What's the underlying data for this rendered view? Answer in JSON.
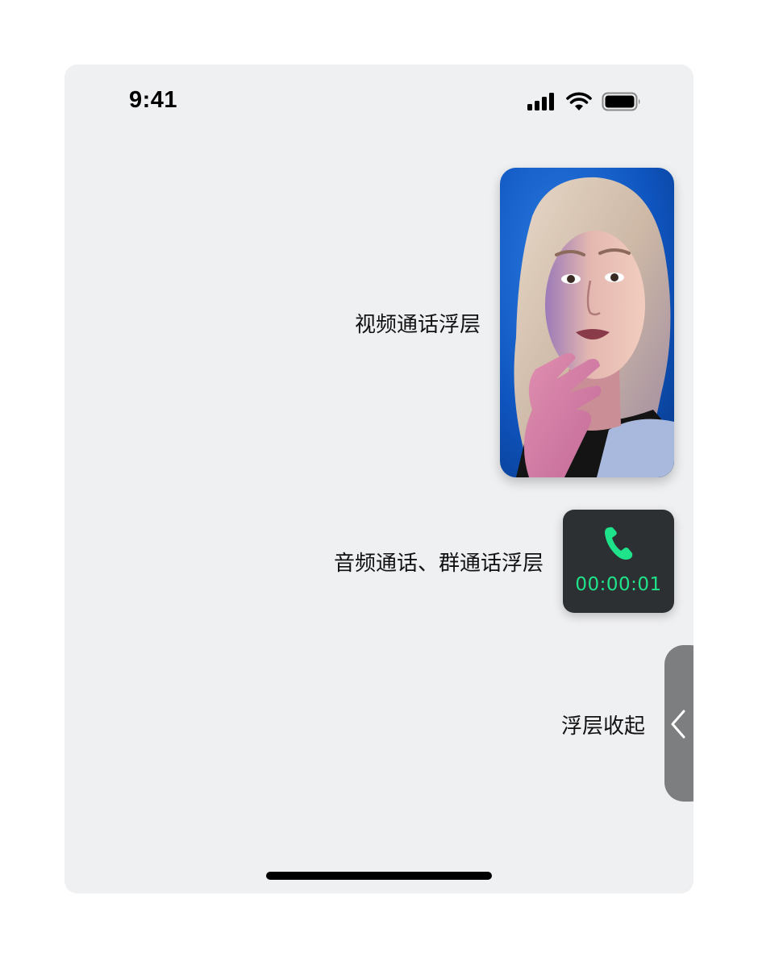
{
  "status_bar": {
    "time": "9:41",
    "icons": [
      "cellular-signal-icon",
      "wifi-icon",
      "battery-icon"
    ]
  },
  "floats": {
    "video": {
      "label": "视频通话浮层",
      "thumbnail": "portrait-video-thumbnail"
    },
    "audio": {
      "label": "音频通话、群通话浮层",
      "icon": "phone-icon",
      "timer": "00:00:01"
    },
    "collapsed": {
      "label": "浮层收起",
      "icon": "chevron-left-icon"
    }
  },
  "colors": {
    "background": "#eff0f2",
    "audio_panel": "#2d3032",
    "accent_green": "#1fe38a",
    "collapse_tab": "#7d7e7f"
  }
}
